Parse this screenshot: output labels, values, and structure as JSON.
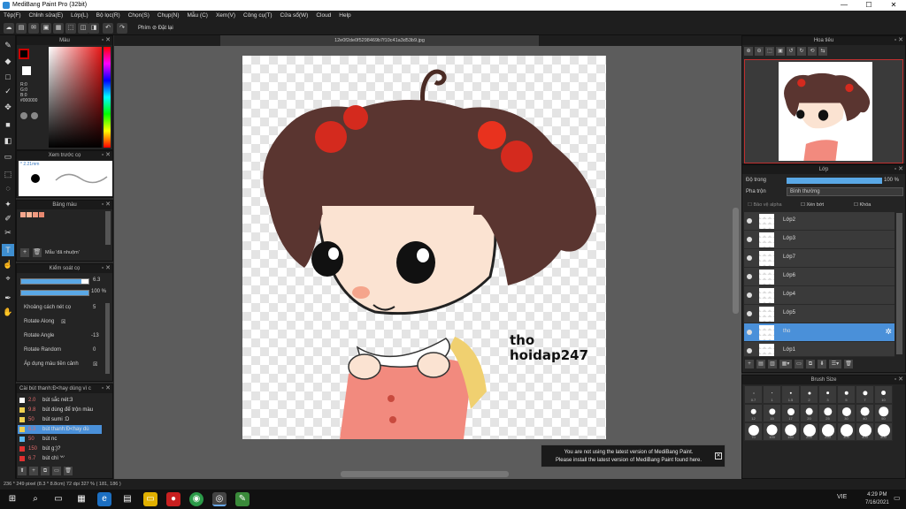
{
  "window": {
    "title": "MediBang Paint Pro (32bit)",
    "controls": [
      "—",
      "☐",
      "✕"
    ]
  },
  "menu": [
    "Tệp(F)",
    "Chỉnh sửa(E)",
    "Lớp(L)",
    "Bộ lọc(R)",
    "Chọn(S)",
    "Chụp(N)",
    "Mẫu (C)",
    "Xem(V)",
    "Công cụ(T)",
    "Cửa sổ(W)",
    "Cloud",
    "Help"
  ],
  "toolbar": {
    "snap_label": "Phím",
    "off_label": "Đặt lại"
  },
  "document": {
    "tab_title": "12e0f2de0f5298469b7f10c41a3d53b9.jpg"
  },
  "color_panel": {
    "title": "Màu",
    "r": "R:0",
    "g": "G:0",
    "b": "B:0",
    "hex": "#000000"
  },
  "brush_preview": {
    "title": "Xem trước cọ",
    "size": "* 2.21mm"
  },
  "palette": {
    "title": "Bảng màu",
    "add_label": "Mẫu 'đã nhuộm'",
    "colors": [
      "#f5a58c",
      "#f8b596",
      "#f09a80",
      "#e88870"
    ]
  },
  "brush_control": {
    "title": "Kiểm soát cọ",
    "size_value": "6.3",
    "size_fill": 0.9,
    "opacity_value": "100 %",
    "opacity_fill": 1.0,
    "options": [
      {
        "label": "Khoảng cách nét cọ",
        "value": "5"
      },
      {
        "label": "Rotate Along",
        "value": "☒"
      },
      {
        "label": "Rotate Angle",
        "value": "-13"
      },
      {
        "label": "Rotate Random",
        "value": "0"
      },
      {
        "label": "Áp dụng màu tiền cảnh",
        "value": "☒"
      }
    ]
  },
  "brush_list": {
    "title": "Cài bút thanh:Đ<hay dùng vì c",
    "items": [
      {
        "size": "2.0",
        "name": "bút sắc nét:3",
        "color": "#ffffff"
      },
      {
        "size": "9.8",
        "name": "bút dùng để trộn màu",
        "color": "#f0d050"
      },
      {
        "size": "50",
        "name": "bút sumi :D",
        "color": "#f0d050"
      },
      {
        "size": "6.3",
        "name": "bút thanh:Đ<hay dù",
        "color": "#f0d050"
      },
      {
        "size": "50",
        "name": "bút nc",
        "color": "#5bb8f0"
      },
      {
        "size": "150",
        "name": "bút g:)?",
        "color": "#e03030"
      },
      {
        "size": "6.7",
        "name": "bút chì '^'",
        "color": "#e03030"
      }
    ],
    "selected_index": 3
  },
  "navigator": {
    "title": "Hoa tiêu"
  },
  "layer_panel": {
    "title": "Lớp",
    "opacity_label": "Độ trong",
    "opacity_value": "100 %",
    "blend_label": "Pha trộn",
    "blend_value": "Bình thường",
    "protect_alpha": "Bảo vệ alpha",
    "clipping": "Xén bớt",
    "lock": "Khóa",
    "layers": [
      "Lớp2",
      "Lớp3",
      "Lớp7",
      "Lớp6",
      "Lớp4",
      "Lớp5",
      "tho",
      "Lớp1"
    ],
    "selected_index": 6
  },
  "brush_size": {
    "title": "Brush Size",
    "sizes": [
      "0.7",
      "1",
      "1.5",
      "2",
      "3",
      "5",
      "7",
      "10",
      "12",
      "15",
      "17",
      "20",
      "25",
      "30",
      "40",
      "50",
      "70",
      "100",
      "150",
      "200",
      "250",
      "300",
      "400",
      "500"
    ]
  },
  "artwork": {
    "caption_line1": "tho",
    "caption_line2": "hoidap247"
  },
  "notification": {
    "line1": "You are not using the latest version of MediBang Paint.",
    "line2": "Please install the latest version of MediBang Paint found here."
  },
  "status": {
    "text": "236 * 249 pixel  (8.3 * 8.8cm)  72 dpi  327 %  ( 181, 186 )"
  },
  "taskbar": {
    "time": "4:29 PM",
    "date": "7/16/2021",
    "lang": "VIE"
  },
  "colors": {
    "accent": "#4a90d9",
    "panel_bg": "#242424",
    "canvas_bg": "#5c5c5c"
  }
}
